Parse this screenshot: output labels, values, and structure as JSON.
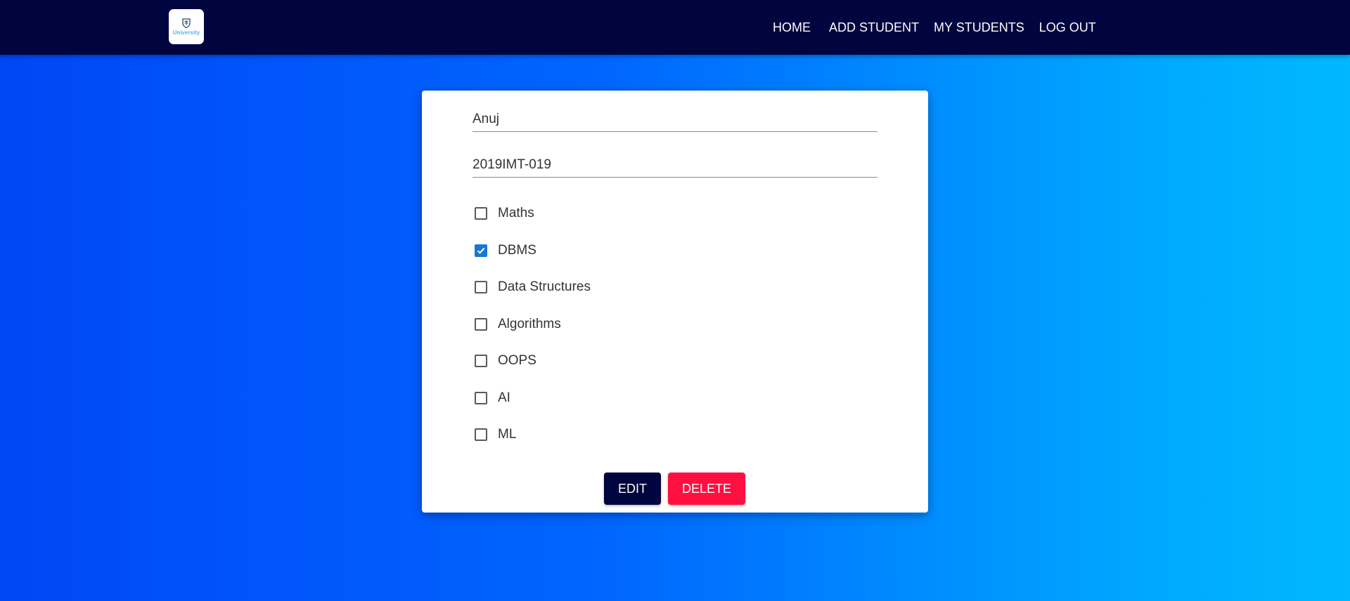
{
  "navbar": {
    "logo_text": "University",
    "links": [
      {
        "label": "HOME"
      },
      {
        "label": "ADD STUDENT"
      },
      {
        "label": "MY STUDENTS"
      },
      {
        "label": "LOG OUT"
      }
    ]
  },
  "form": {
    "name_value": "Anuj",
    "roll_value": "2019IMT-019",
    "subjects": [
      {
        "label": "Maths",
        "checked": false
      },
      {
        "label": "DBMS",
        "checked": true
      },
      {
        "label": "Data Structures",
        "checked": false
      },
      {
        "label": "Algorithms",
        "checked": false
      },
      {
        "label": "OOPS",
        "checked": false
      },
      {
        "label": "AI",
        "checked": false
      },
      {
        "label": "ML",
        "checked": false
      }
    ],
    "edit_label": "EDIT",
    "delete_label": "DELETE"
  },
  "colors": {
    "navbar_bg": "#00043f",
    "checkbox_checked": "#1976d2",
    "edit_button": "#00043f",
    "delete_button": "#ff1040",
    "logo_text": "#5ab3e8"
  }
}
